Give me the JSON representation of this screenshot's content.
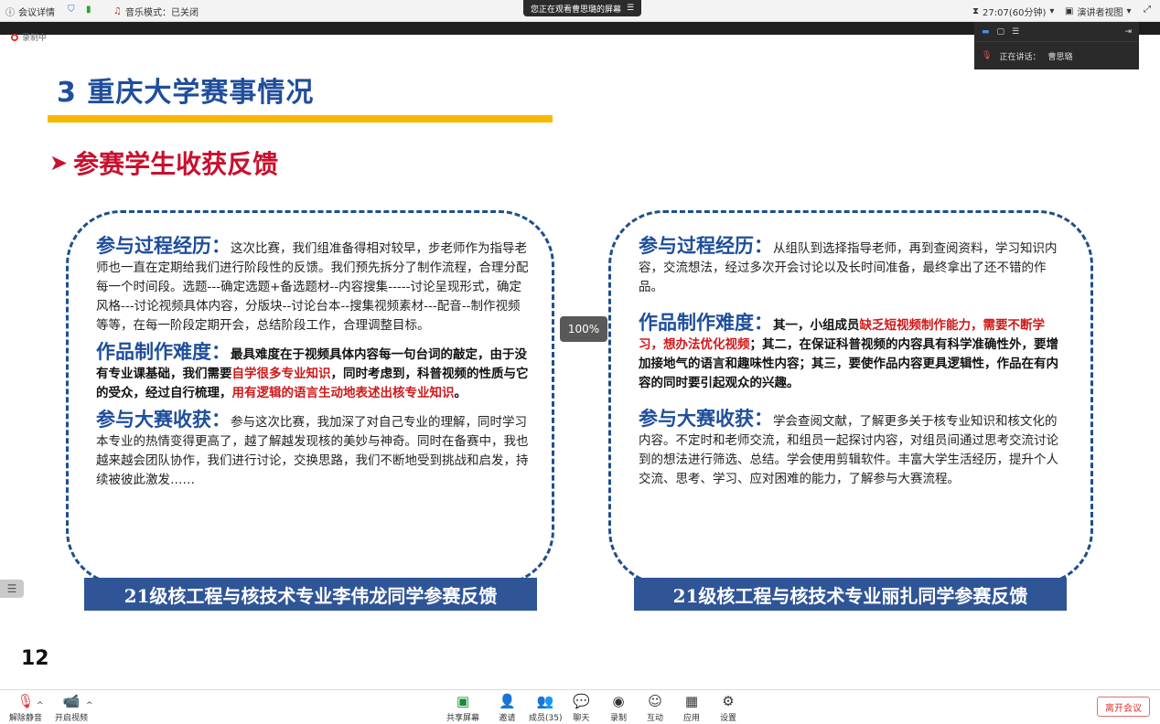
{
  "topbar": {
    "meeting_info": "会议详情",
    "music_mode": "音乐模式：已关闭",
    "viewing_banner": "您正在观看曹思璐的屏幕",
    "timer": "27:07(60分钟)",
    "view_mode": "演讲者视图"
  },
  "recording_label": "录制中",
  "speaker_panel": {
    "speaking_label": "正在讲话：",
    "speaker_name": "曹思璐"
  },
  "slide": {
    "title": "3 重庆大学赛事情况",
    "subtitle": "参赛学生收获反馈",
    "left": {
      "s1_head": "参与过程经历：",
      "s1_text": "这次比赛，我们组准备得相对较早，步老师作为指导老师也一直在定期给我们进行阶段性的反馈。我们预先拆分了制作流程，合理分配每一个时间段。选题---确定选题+备选题材--内容搜集-----讨论呈现形式，确定风格---讨论视频具体内容，分版块--讨论台本--搜集视频素材---配音--制作视频等等，在每一阶段定期开会，总结阶段工作，合理调整目标。",
      "s2_head": "作品制作难度：",
      "s2_a": "最具难度在于视频具体内容每一句台词的敲定，由于没有专业课基础，我们需要",
      "s2_red1": "自学很多专业知识",
      "s2_b": "，同时考虑到，科普视频的性质与它的受众，经过自行梳理，",
      "s2_red2": "用有逻辑的语言生动地表述出核专业知识",
      "s2_c": "。",
      "s3_head": "参与大赛收获：",
      "s3_text": "参与这次比赛，我加深了对自己专业的理解，同时学习本专业的热情变得更高了，越了解越发现核的美妙与神奇。同时在备赛中，我也越来越会团队协作，我们进行讨论，交换思路，我们不断地受到挑战和启发，持续被彼此激发……",
      "caption": "21级核工程与核技术专业李伟龙同学参赛反馈"
    },
    "right": {
      "s1_head": "参与过程经历：",
      "s1_text": "从组队到选择指导老师，再到查阅资料，学习知识内容，交流想法，经过多次开会讨论以及长时间准备，最终拿出了还不错的作品。",
      "s2_head": "作品制作难度：",
      "s2_a": "其一，小组成员",
      "s2_red1": "缺乏短视频制作能力，需要不断学习，想办法优化视频",
      "s2_b": "；其二，在保证科普视频的内容具有科学准确性外，要增加接地气的语言和趣味性内容；其三，要使作品内容更具逻辑性，作品在有内容的同时要引起观众的兴趣。",
      "s3_head": "参与大赛收获：",
      "s3_text": "学会查阅文献，了解更多关于核专业知识和核文化的内容。不定时和老师交流，和组员一起探讨内容，对组员间通过思考交流讨论到的想法进行筛选、总结。学会使用剪辑软件。丰富大学生活经历，提升个人交流、思考、学习、应对困难的能力，了解参与大赛流程。",
      "caption": "21级核工程与核技术专业丽扎同学参赛反馈"
    },
    "page_number": "12"
  },
  "zoom_level": "100%",
  "bottombar": {
    "mute": "解除静音",
    "video": "开启视频",
    "share": "共享屏幕",
    "invite": "邀请",
    "members": "成员(35)",
    "chat": "聊天",
    "record": "录制",
    "interact": "互动",
    "apps": "应用",
    "settings": "设置",
    "leave": "离开会议"
  },
  "colors": {
    "title_blue": "#1f4e9b",
    "accent_yellow": "#f7b800",
    "red": "#c8102e",
    "caption_blue": "#2f5597"
  }
}
